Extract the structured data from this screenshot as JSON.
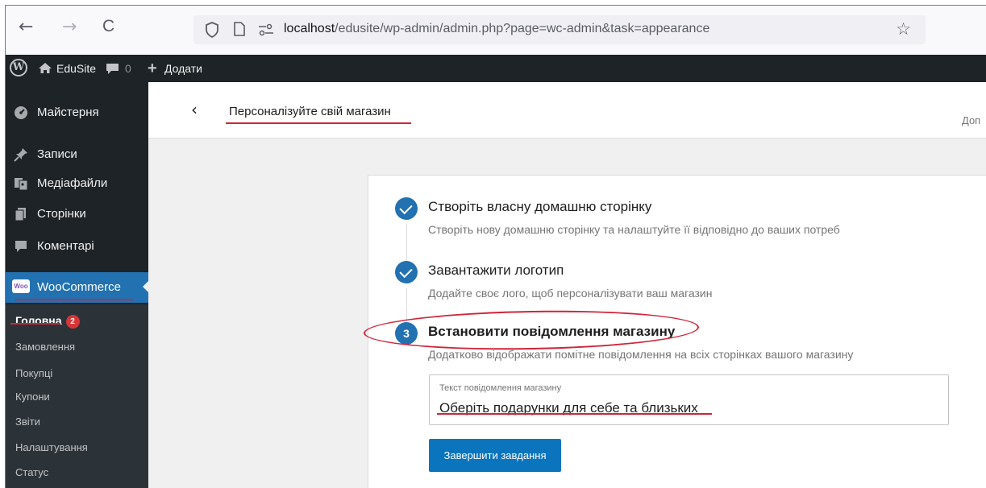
{
  "browser": {
    "back_glyph": "←",
    "forward_glyph": "→",
    "reload_glyph": "C",
    "url_host": "localhost",
    "url_path": "/edusite/wp-admin/admin.php?page=wc-admin&task=appearance",
    "icons": [
      "shield-icon",
      "page-icon",
      "site-permissions-icon",
      "bookmark-star-icon"
    ]
  },
  "adminbar": {
    "site_name": "EduSite",
    "comments_count": "0",
    "add_new_label": "Додати"
  },
  "sidebar": {
    "items": [
      {
        "label": "Майстерня",
        "icon": "dashboard-icon"
      },
      {
        "label": "Записи",
        "icon": "pin-icon"
      },
      {
        "label": "Медіафайли",
        "icon": "media-icon"
      },
      {
        "label": "Сторінки",
        "icon": "pages-icon"
      },
      {
        "label": "Коментарі",
        "icon": "comment-icon"
      }
    ],
    "woocommerce": {
      "label": "WooCommerce",
      "badge_text": "Woo"
    },
    "submenu": [
      {
        "label": "Головна",
        "count": "2",
        "active": true
      },
      {
        "label": "Замовлення"
      },
      {
        "label": "Покупці"
      },
      {
        "label": "Купони"
      },
      {
        "label": "Звіти"
      },
      {
        "label": "Налаштування"
      },
      {
        "label": "Статус"
      }
    ]
  },
  "header": {
    "back_glyph": "‹",
    "title": "Персоналізуйте свій магазин",
    "help_partial": "Доп"
  },
  "steps": [
    {
      "title": "Створіть власну домашню сторінку",
      "desc": "Створіть нову домашню сторінку та налаштуйте її відповідно до ваших потреб",
      "done": true
    },
    {
      "title": "Завантажити логотип",
      "desc": "Додайте своє лого, щоб персоналізувати ваш магазин",
      "done": true
    },
    {
      "number": "3",
      "title": "Встановити повідомлення магазину",
      "desc": "Додатково відображати помітне повідомлення на всіх сторінках вашого магазину",
      "done": false
    }
  ],
  "notice_field": {
    "label": "Текст повідомлення магазину",
    "value": "Оберіть подарунки для себе та близьких"
  },
  "complete_button": "Завершити завдання",
  "colors": {
    "accent": "#2271b1",
    "admin_dark": "#1d2327",
    "annotation_red": "#d0243a"
  }
}
